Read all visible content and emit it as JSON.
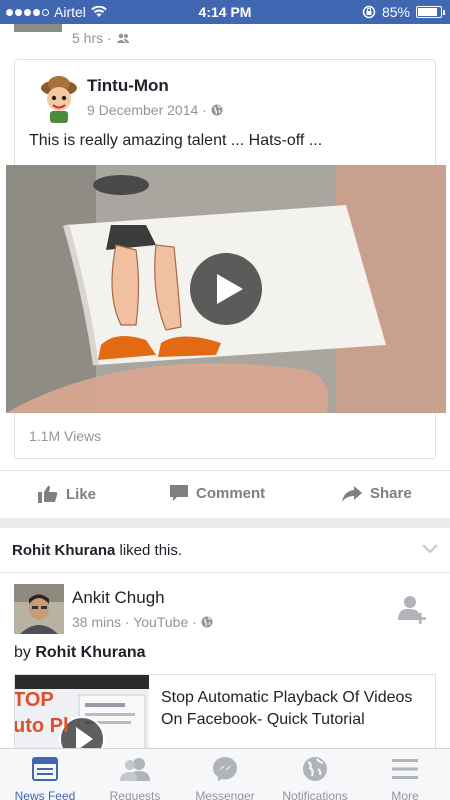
{
  "status_bar": {
    "carrier": "Airtel",
    "time": "4:14 PM",
    "battery": "85%",
    "battery_level": 0.85
  },
  "previous_post": {
    "meta": "5 hrs ·"
  },
  "post1": {
    "author": "Tintu-Mon",
    "date": "9 December 2014 ·",
    "text": "This is really amazing talent ... Hats-off ...",
    "views": "1.1M Views"
  },
  "actions": {
    "like": "Like",
    "comment": "Comment",
    "share": "Share"
  },
  "post2": {
    "liked_by": "Rohit Khurana",
    "liked_suffix": " liked this.",
    "author": "Ankit Chugh",
    "meta": "38 mins · YouTube ·",
    "by_prefix": "by ",
    "by_name": "Rohit Khurana",
    "link_title": "Stop Automatic Playback Of Videos On Facebook- Quick Tutorial",
    "thumb_text_1": "TOP",
    "thumb_text_2": "uto Pl"
  },
  "tabs": [
    {
      "label": "News Feed",
      "icon": "news-feed-icon",
      "active": true
    },
    {
      "label": "Requests",
      "icon": "friend-requests-icon"
    },
    {
      "label": "Messenger",
      "icon": "messenger-icon"
    },
    {
      "label": "Notifications",
      "icon": "globe-icon"
    },
    {
      "label": "More",
      "icon": "menu-icon"
    }
  ],
  "colors": {
    "brand": "#4267b2",
    "background": "#e9ebee",
    "secondary_text": "#90949c"
  }
}
